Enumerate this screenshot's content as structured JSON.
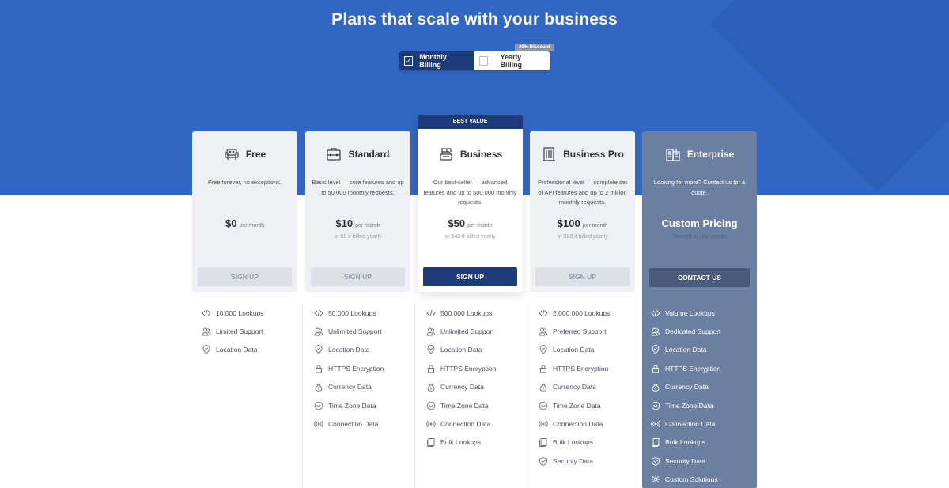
{
  "header": {
    "title": "Plans that scale with your business"
  },
  "billing_toggle": {
    "monthly_label": "Monthly Billing",
    "monthly_checked": true,
    "yearly_label": "Yearly Billing",
    "yearly_checked": false,
    "discount_badge": "20% Discount"
  },
  "colors": {
    "hero_blue": "#3166c2",
    "navy": "#1d3b78",
    "enterprise_slate": "#6b80a1",
    "card_gray": "#eef0f4"
  },
  "plans": [
    {
      "name": "Free",
      "icon": "armchair-icon",
      "description": "Free forever, no exceptions.",
      "price": "$0",
      "per": "per month",
      "yearly_note": "",
      "button": "SIGN UP",
      "features": [
        {
          "icon": "code-icon",
          "label": "10.000 Lookups"
        },
        {
          "icon": "users-icon",
          "label": "Limited Support"
        },
        {
          "icon": "location-pin-icon",
          "label": "Location Data"
        }
      ]
    },
    {
      "name": "Standard",
      "icon": "briefcase-icon",
      "description": "Basic level — core features and up to 50.000 monthly requests.",
      "price": "$10",
      "per": "per month",
      "yearly_note": "or $8 if billed yearly",
      "button": "SIGN UP",
      "features": [
        {
          "icon": "code-icon",
          "label": "50.000 Lookups"
        },
        {
          "icon": "users-icon",
          "label": "Unlimited Support"
        },
        {
          "icon": "location-pin-icon",
          "label": "Location Data"
        },
        {
          "icon": "lock-icon",
          "label": "HTTPS Encryption"
        },
        {
          "icon": "money-bag-icon",
          "label": "Currency Data"
        },
        {
          "icon": "clock-icon",
          "label": "Time Zone Data"
        },
        {
          "icon": "signal-icon",
          "label": "Connection Data"
        }
      ]
    },
    {
      "name": "Business",
      "icon": "cash-register-icon",
      "badge": "BEST VALUE",
      "description": "Our best-seller — advanced features and up to 500.000 monthly requests.",
      "price": "$50",
      "per": "per month",
      "yearly_note": "or $40 if billed yearly",
      "button": "SIGN UP",
      "features": [
        {
          "icon": "code-icon",
          "label": "500.000 Lookups"
        },
        {
          "icon": "users-icon",
          "label": "Unlimited Support"
        },
        {
          "icon": "location-pin-icon",
          "label": "Location Data"
        },
        {
          "icon": "lock-icon",
          "label": "HTTPS Encryption"
        },
        {
          "icon": "money-bag-icon",
          "label": "Currency Data"
        },
        {
          "icon": "clock-icon",
          "label": "Time Zone Data"
        },
        {
          "icon": "signal-icon",
          "label": "Connection Data"
        },
        {
          "icon": "documents-icon",
          "label": "Bulk Lookups"
        }
      ]
    },
    {
      "name": "Business Pro",
      "icon": "building-icon",
      "description": "Professional level — complete set of API features and up to 2 million monthly requests.",
      "price": "$100",
      "per": "per month",
      "yearly_note": "or $80 if billed yearly",
      "button": "SIGN UP",
      "features": [
        {
          "icon": "code-icon",
          "label": "2.000.000 Lookups"
        },
        {
          "icon": "users-icon",
          "label": "Preferred Support"
        },
        {
          "icon": "location-pin-icon",
          "label": "Location Data"
        },
        {
          "icon": "lock-icon",
          "label": "HTTPS Encryption"
        },
        {
          "icon": "money-bag-icon",
          "label": "Currency Data"
        },
        {
          "icon": "clock-icon",
          "label": "Time Zone Data"
        },
        {
          "icon": "signal-icon",
          "label": "Connection Data"
        },
        {
          "icon": "documents-icon",
          "label": "Bulk Lookups"
        },
        {
          "icon": "shield-icon",
          "label": "Security Data"
        }
      ]
    },
    {
      "name": "Enterprise",
      "icon": "office-buildings-icon",
      "description": "Looking for more? Contact us for a quote.",
      "price": "Custom Pricing",
      "yearly_note": "Tailored to your needs",
      "button": "CONTACT US",
      "features": [
        {
          "icon": "code-icon",
          "label": "Volume Lookups"
        },
        {
          "icon": "users-icon",
          "label": "Dedicated Support"
        },
        {
          "icon": "location-pin-icon",
          "label": "Location Data"
        },
        {
          "icon": "lock-icon",
          "label": "HTTPS Encryption"
        },
        {
          "icon": "money-bag-icon",
          "label": "Currency Data"
        },
        {
          "icon": "clock-icon",
          "label": "Time Zone Data"
        },
        {
          "icon": "signal-icon",
          "label": "Connection Data"
        },
        {
          "icon": "documents-icon",
          "label": "Bulk Lookups"
        },
        {
          "icon": "shield-icon",
          "label": "Security Data"
        },
        {
          "icon": "gear-icon",
          "label": "Custom Solutions"
        }
      ]
    }
  ]
}
